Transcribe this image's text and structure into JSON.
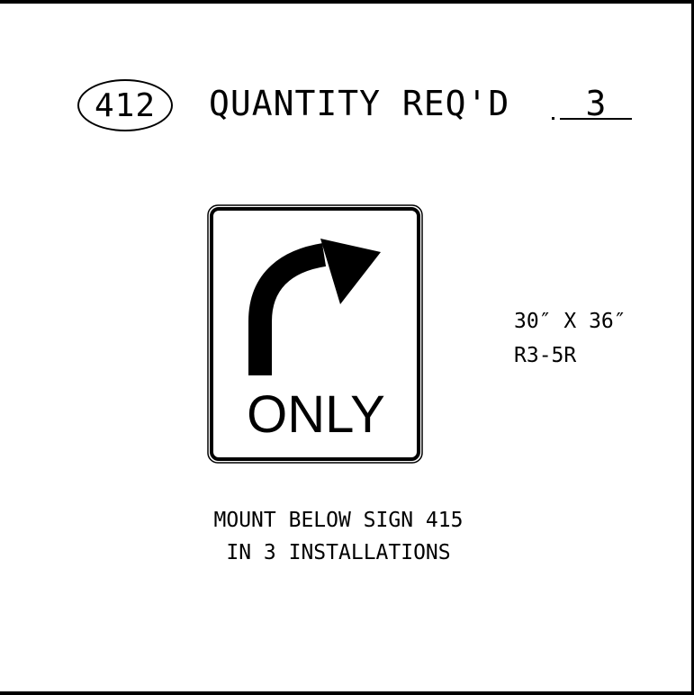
{
  "sheet": {
    "sign_number": "412",
    "quantity_label": "QUANTITY REQ'D",
    "quantity_value": "3"
  },
  "sign": {
    "legend": "ONLY",
    "arrow_direction": "right-turn",
    "colors": {
      "background": "#ffffff",
      "border": "#000000",
      "legend": "#000000"
    }
  },
  "size": {
    "dimensions": "30″ X 36″",
    "code": "R3-5R"
  },
  "notes": [
    "MOUNT BELOW SIGN 415",
    "IN 3 INSTALLATIONS"
  ]
}
